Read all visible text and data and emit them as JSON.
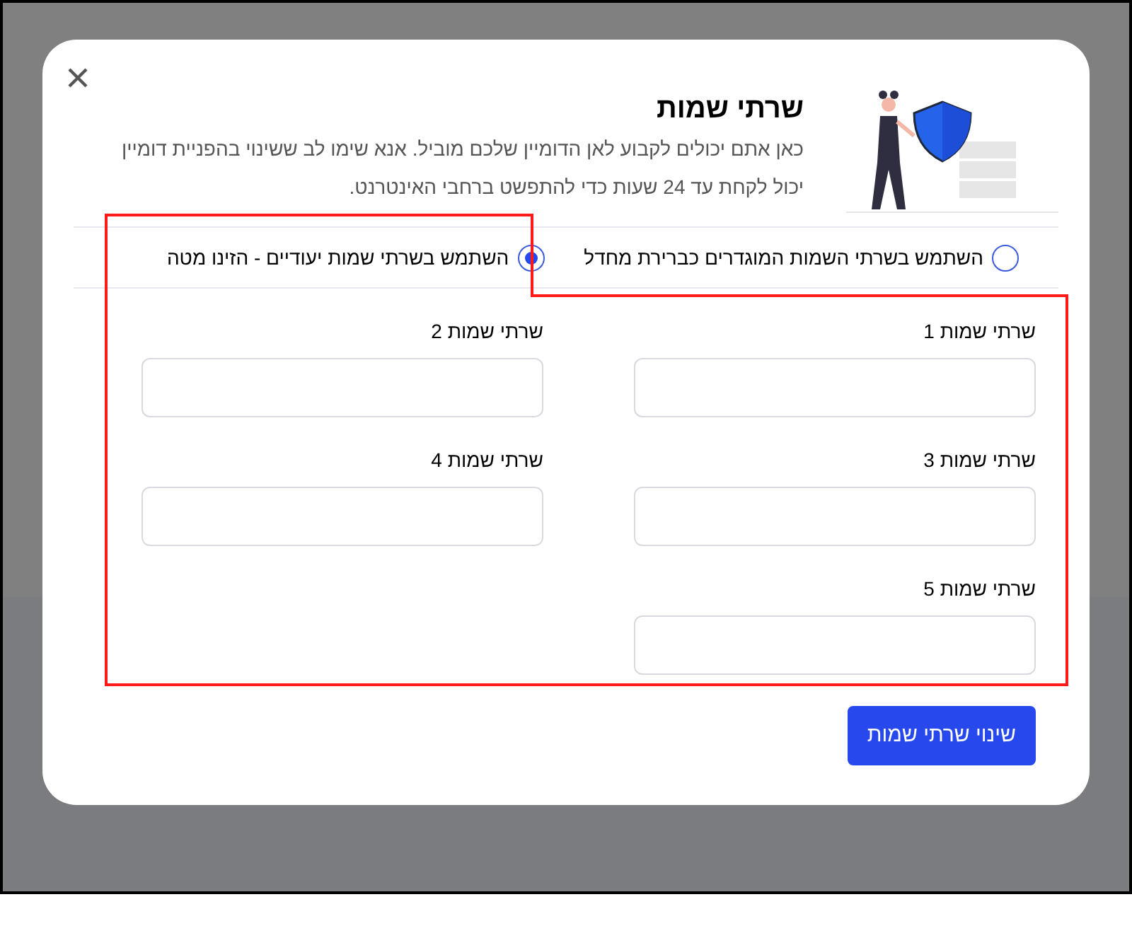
{
  "dialog": {
    "title": "שרתי שמות",
    "description": "כאן אתם יכולים לקבוע לאן הדומיין שלכם מוביל. אנא שימו לב ששינוי בהפניית דומיין יכול לקחת עד 24 שעות כדי להתפשט ברחבי האינטרנט.",
    "options": [
      {
        "label": "השתמש בשרתי השמות המוגדרים כברירת מחדל",
        "selected": false
      },
      {
        "label": "השתמש בשרתי שמות יעודיים - הזינו מטה",
        "selected": true
      }
    ],
    "fields": [
      {
        "label": "שרתי שמות 1"
      },
      {
        "label": "שרתי שמות 2"
      },
      {
        "label": "שרתי שמות 3"
      },
      {
        "label": "שרתי שמות 4"
      },
      {
        "label": "שרתי שמות 5"
      }
    ],
    "submit_button": "שינוי שרתי שמות"
  }
}
